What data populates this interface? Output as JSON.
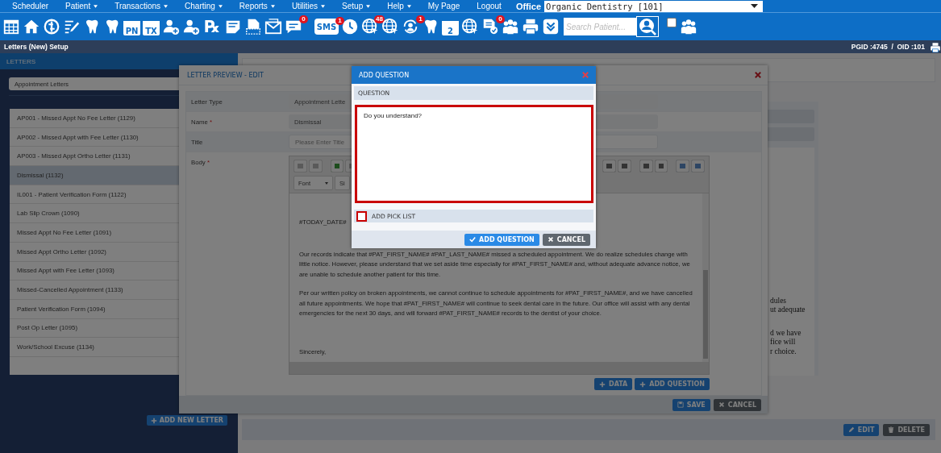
{
  "menu": {
    "items": [
      {
        "label": "Scheduler",
        "has_menu": false
      },
      {
        "label": "Patient",
        "has_menu": true
      },
      {
        "label": "Transactions",
        "has_menu": true
      },
      {
        "label": "Charting",
        "has_menu": true
      },
      {
        "label": "Reports",
        "has_menu": true
      },
      {
        "label": "Utilities",
        "has_menu": true
      },
      {
        "label": "Setup",
        "has_menu": true
      },
      {
        "label": "Help",
        "has_menu": true
      },
      {
        "label": "My Page",
        "has_menu": false
      },
      {
        "label": "Logout",
        "has_menu": false
      }
    ],
    "office_label": "Office",
    "office_select": "Organic Dentistry [101]"
  },
  "toolbar": {
    "icon_labels": [
      "PN",
      "TX",
      "℞",
      "SMS",
      "2"
    ],
    "badges": [
      "0",
      "1",
      "48",
      "1",
      "0"
    ],
    "search_placeholder": "Search Patient...",
    "checkbox_checked": false
  },
  "title_bar": {
    "title": "Letters (New) Setup",
    "ids": "PGID :4745  /  OID :101"
  },
  "letters_panel": {
    "header": "LETTERS",
    "category": "Appointment Letters",
    "items": [
      {
        "label": "AP001 - Missed Appt No Fee Letter (1129)",
        "selected": false
      },
      {
        "label": "AP002 - Missed Appt with Fee Letter (1130)",
        "selected": false
      },
      {
        "label": "AP003 - Missed Appt Ortho Letter (1131)",
        "selected": false
      },
      {
        "label": "Dismissal (1132)",
        "selected": true
      },
      {
        "label": "IL001 - Patient Verification Form (1122)",
        "selected": false
      },
      {
        "label": "Lab Slip Crown (1090)",
        "selected": false
      },
      {
        "label": "Missed Appt No Fee Letter (1091)",
        "selected": false
      },
      {
        "label": "Missed Appt Ortho Letter (1092)",
        "selected": false
      },
      {
        "label": "Missed Appt with Fee Letter (1093)",
        "selected": false
      },
      {
        "label": "Missed-Cancelled Appointment (1133)",
        "selected": false
      },
      {
        "label": "Patient Verification Form (1094)",
        "selected": false
      },
      {
        "label": "Post Op Letter (1095)",
        "selected": false
      },
      {
        "label": "Work/School Excuse (1134)",
        "selected": false
      }
    ],
    "add_button": "ADD NEW LETTER"
  },
  "letter_preview": {
    "fragments": [
      [
        "dules",
        "ut adequate"
      ],
      [
        "d we have",
        "fice will",
        "r choice."
      ]
    ],
    "actions": [
      "EDIT",
      "DELETE"
    ]
  },
  "edit_dialog": {
    "title": "LETTER PREVIEW - EDIT",
    "fields": [
      {
        "label": "Letter Type",
        "value": "Appointment Lette"
      },
      {
        "label": "Name",
        "required_mark": "*",
        "value": "Dismissal"
      },
      {
        "label": "Title",
        "placeholder": "Please Enter Title"
      }
    ],
    "body_label": "Body",
    "body_required_mark": "*",
    "editor": {
      "font_select": "Font",
      "size_select": "Si",
      "date_token": "#TODAY_DATE#",
      "paragraphs": [
        "Our records indicate that #PAT_FIRST_NAME# #PAT_LAST_NAME# missed a scheduled appointment. We do realize schedules change with little notice. However, please understand that we set aside time especially for #PAT_FIRST_NAME# and, without adequate advance notice, we are unable to schedule another patient for this time.",
        "Per our written policy on broken appointments, we cannot continue to schedule appointments for #PAT_FIRST_NAME#, and we have cancelled all future appointments. We hope that #PAT_FIRST_NAME# will continue to seek dental care in the future. Our office will assist with any dental emergencies for the next 30 days, and will forward #PAT_FIRST_NAME# records to the dentist of your choice."
      ],
      "closing": "Sincerely,"
    },
    "insert_buttons": [
      "DATA",
      "ADD QUESTION"
    ],
    "save": "SAVE",
    "cancel": "CANCEL"
  },
  "add_question_dialog": {
    "title": "ADD QUESTION",
    "section": "QUESTION",
    "question": "Do you understand?",
    "question_invalid": true,
    "pick_list_label": "ADD PICK LIST",
    "pick_list_checked": false,
    "confirm": "ADD QUESTION",
    "cancel": "CANCEL"
  }
}
